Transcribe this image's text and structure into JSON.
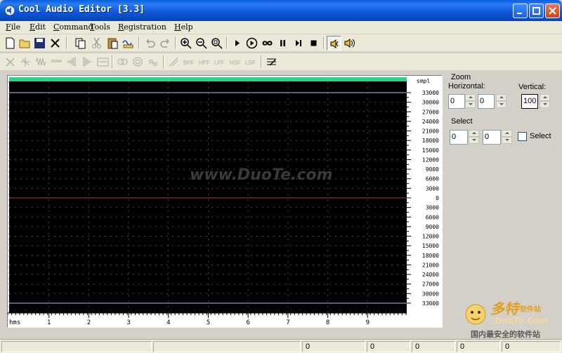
{
  "window": {
    "title": "Cool Audio Editor [3.3]"
  },
  "menu": [
    {
      "accel": "F",
      "rest": "ile"
    },
    {
      "accel": "E",
      "rest": "dit"
    },
    {
      "accel": "C",
      "rest": "ommand"
    },
    {
      "accel": "T",
      "rest": "ools"
    },
    {
      "accel": "R",
      "rest": "egistration"
    },
    {
      "accel": "H",
      "rest": "elp"
    }
  ],
  "filters": {
    "bpf": "BPF",
    "hpf": "HPF",
    "lpf": "LPF",
    "hsf": "HSF",
    "lsf": "LSF"
  },
  "waveform": {
    "amp_unit": "smpl",
    "amp_labels": [
      "33000",
      "30000",
      "27000",
      "24000",
      "21000",
      "18000",
      "15000",
      "12000",
      "9000",
      "6000",
      "3000",
      "0",
      "3000",
      "6000",
      "9000",
      "12000",
      "15000",
      "18000",
      "21000",
      "24000",
      "27000",
      "30000",
      "33000"
    ],
    "time_unit": "hms",
    "time_labels": [
      "1",
      "2",
      "3",
      "4",
      "5",
      "6",
      "7",
      "8",
      "9"
    ],
    "colors": {
      "background": "#000000",
      "overview_bar": "#2fd08a",
      "center_line": "#c0303a",
      "limit_line": "#a0c0ff",
      "grid": "#4a4a4a"
    }
  },
  "zoom": {
    "title": "Zoom",
    "horizontal_label": "Horizontal:",
    "vertical_label": "Vertical:",
    "h_from": "0",
    "h_to": "0",
    "vertical": "100"
  },
  "select": {
    "title": "Select",
    "from": "0",
    "to": "0",
    "checkbox_label": "Select"
  },
  "watermark": {
    "center": "www.DuoTe.com",
    "corner_cn": "多特",
    "corner_sub": "软件站",
    "corner_site": "DuoTe.Com",
    "corner_slogan": "国内最安全的软件站"
  },
  "status": [
    "0",
    "0",
    "0",
    "0",
    "0"
  ]
}
